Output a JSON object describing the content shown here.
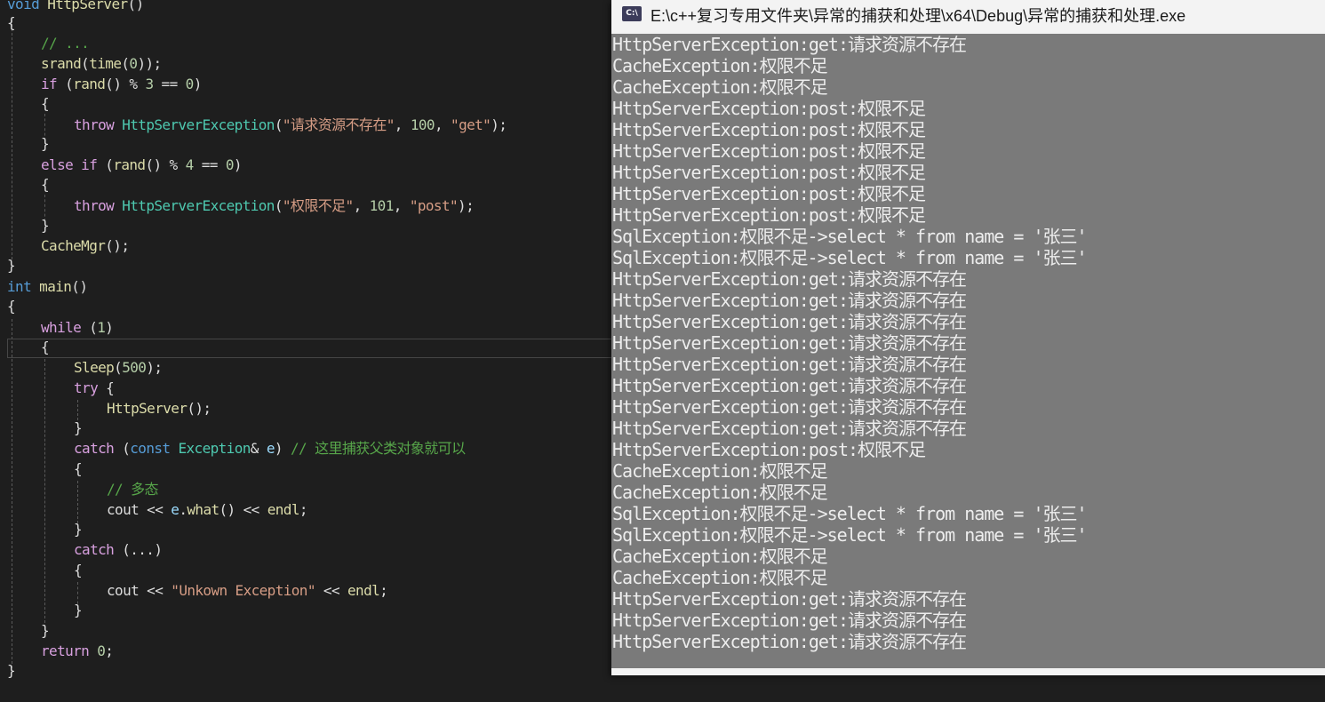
{
  "window": {
    "title": "E:\\c++复习专用文件夹\\异常的捕获和处理\\x64\\Debug\\异常的捕获和处理.exe",
    "icon": "C:\\"
  },
  "code": {
    "l1": [
      "void",
      "HttpServer",
      "()"
    ],
    "l2": "{",
    "l3": "// ...",
    "l4": [
      "srand",
      "(",
      "time",
      "(",
      "0",
      "));"
    ],
    "l5": [
      "if",
      " (",
      "rand",
      "() % ",
      "3",
      " == ",
      "0",
      ")"
    ],
    "l6": "{",
    "l7": [
      "throw",
      "HttpServerException",
      "(",
      "\"请求资源不存在\"",
      ", ",
      "100",
      ", ",
      "\"get\"",
      ");"
    ],
    "l8": "}",
    "l9": [
      "else if",
      " (",
      "rand",
      "() % ",
      "4",
      " == ",
      "0",
      ")"
    ],
    "l10": "{",
    "l11": [
      "throw",
      "HttpServerException",
      "(",
      "\"权限不足\"",
      ", ",
      "101",
      ", ",
      "\"post\"",
      ");"
    ],
    "l12": "}",
    "l13": [
      "CacheMgr",
      "();"
    ],
    "l14": "}",
    "l15": [
      "int",
      "main",
      "()"
    ],
    "l16": "{",
    "l17": [
      "while",
      " (",
      "1",
      ")"
    ],
    "l18": "{",
    "l19": [
      "Sleep",
      "(",
      "500",
      ");"
    ],
    "l20": [
      "try",
      " {"
    ],
    "l21": [
      "HttpServer",
      "();"
    ],
    "l22": "}",
    "l23": [
      "catch",
      " (",
      "const",
      "Exception",
      "& ",
      "e",
      ") ",
      "// 这里捕获父类对象就可以"
    ],
    "l24": "{",
    "l25": "// 多态",
    "l26": [
      "cout",
      " << ",
      "e",
      ".",
      "what",
      "() << ",
      "endl",
      ";"
    ],
    "l27": "}",
    "l28": [
      "catch",
      " (...)"
    ],
    "l29": "{",
    "l30": [
      "cout",
      " << ",
      "\"Unkown Exception\"",
      " << ",
      "endl",
      ";"
    ],
    "l31": "}",
    "l32": "}",
    "l33": [
      "return",
      " ",
      "0",
      ";"
    ],
    "l34": "}"
  },
  "console": {
    "lines": [
      "HttpServerException:get:请求资源不存在",
      "CacheException:权限不足",
      "CacheException:权限不足",
      "HttpServerException:post:权限不足",
      "HttpServerException:post:权限不足",
      "HttpServerException:post:权限不足",
      "HttpServerException:post:权限不足",
      "HttpServerException:post:权限不足",
      "HttpServerException:post:权限不足",
      "SqlException:权限不足->select * from name = '张三'",
      "SqlException:权限不足->select * from name = '张三'",
      "HttpServerException:get:请求资源不存在",
      "HttpServerException:get:请求资源不存在",
      "HttpServerException:get:请求资源不存在",
      "HttpServerException:get:请求资源不存在",
      "HttpServerException:get:请求资源不存在",
      "HttpServerException:get:请求资源不存在",
      "HttpServerException:get:请求资源不存在",
      "HttpServerException:get:请求资源不存在",
      "HttpServerException:post:权限不足",
      "CacheException:权限不足",
      "CacheException:权限不足",
      "SqlException:权限不足->select * from name = '张三'",
      "SqlException:权限不足->select * from name = '张三'",
      "CacheException:权限不足",
      "CacheException:权限不足",
      "HttpServerException:get:请求资源不存在",
      "HttpServerException:get:请求资源不存在",
      "HttpServerException:get:请求资源不存在"
    ]
  },
  "colors": {
    "editor_bg": "#1e1e1e",
    "keyword": "#569cd6",
    "control": "#d8a0df",
    "type": "#4ec9b0",
    "function": "#dcdcaa",
    "string": "#d69d85",
    "number": "#b5cea8",
    "comment": "#57a64a",
    "console_bg": "#7a7a7a"
  }
}
